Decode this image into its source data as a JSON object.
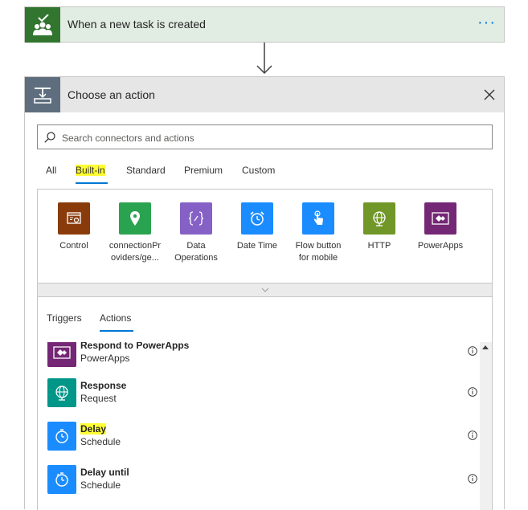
{
  "trigger": {
    "title": "When a new task is created",
    "more_label": "···",
    "icon": "team-icon",
    "color": "#31752f"
  },
  "action_card": {
    "title": "Choose an action",
    "icon": "choose-action-icon",
    "close_icon": "close-icon",
    "search_placeholder": "Search connectors and actions",
    "tabs": [
      "All",
      "Built-in",
      "Standard",
      "Premium",
      "Custom"
    ],
    "active_tab": "Built-in"
  },
  "connectors": [
    {
      "label": "Control",
      "icon": "control-icon",
      "color": "#8a3b0c"
    },
    {
      "label": "connectionPr oviders/ge...",
      "icon": "location-pin-icon",
      "color": "#2aa350"
    },
    {
      "label": "Data Operations",
      "icon": "braces-icon",
      "color": "#8661c5"
    },
    {
      "label": "Date Time",
      "icon": "alarm-clock-icon",
      "color": "#1a8cff"
    },
    {
      "label": "Flow button for mobile",
      "icon": "tap-icon",
      "color": "#1a8cff"
    },
    {
      "label": "HTTP",
      "icon": "globe-icon",
      "color": "#709727"
    },
    {
      "label": "PowerApps",
      "icon": "powerapps-icon",
      "color": "#742774"
    }
  ],
  "actions_panel": {
    "tabs": [
      "Triggers",
      "Actions"
    ],
    "active_tab": "Actions",
    "items": [
      {
        "name": "Respond to PowerApps",
        "sub": "PowerApps",
        "icon": "powerapps-icon",
        "color": "#742774"
      },
      {
        "name": "Response",
        "sub": "Request",
        "icon": "globe-icon",
        "color": "#009688"
      },
      {
        "name": "Delay",
        "sub": "Schedule",
        "icon": "timer-icon",
        "color": "#1a8cff"
      },
      {
        "name": "Delay until",
        "sub": "Schedule",
        "icon": "timer-icon",
        "color": "#1a8cff"
      }
    ]
  }
}
